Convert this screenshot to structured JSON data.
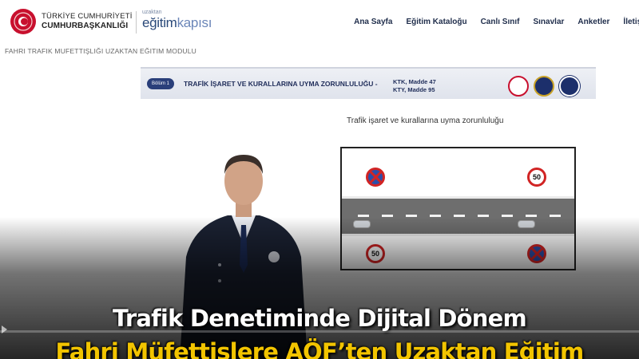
{
  "header": {
    "org_line1": "TÜRKİYE CUMHURİYETİ",
    "org_line2": "CUMHURBAŞKANLIĞI",
    "portal_small": "uzaktan",
    "portal_main": "eğitim",
    "portal_main_light": "kapısı",
    "nav": [
      "Ana Sayfa",
      "Eğitim Kataloğu",
      "Canlı Sınıf",
      "Sınavlar",
      "Anketler",
      "İletişi"
    ]
  },
  "module_title": "FAHRI TRAFIK MUFETTIŞLIĞI UZAKTAN EĞITIM MODULU",
  "slide": {
    "chapter": "Bölüm 1",
    "heading": "TRAFİK İŞARET VE KURALLARINA UYMA ZORUNLULUĞU -",
    "ref1": "KTK, Madde 47",
    "ref2": "KTY, Madde 95",
    "subtitle": "Trafik işaret ve kurallarına uyma zorunluluğu",
    "speed_limit": "50"
  },
  "caption": {
    "line1": "Trafik Denetiminde Dijital Dönem",
    "line2": "Fahri Müfettişlere AÖF’ten Uzaktan Eğitim"
  },
  "colors": {
    "nav_text": "#1f2d4b",
    "caption_yellow": "#f2c400",
    "emblem_red": "#c8102e"
  }
}
